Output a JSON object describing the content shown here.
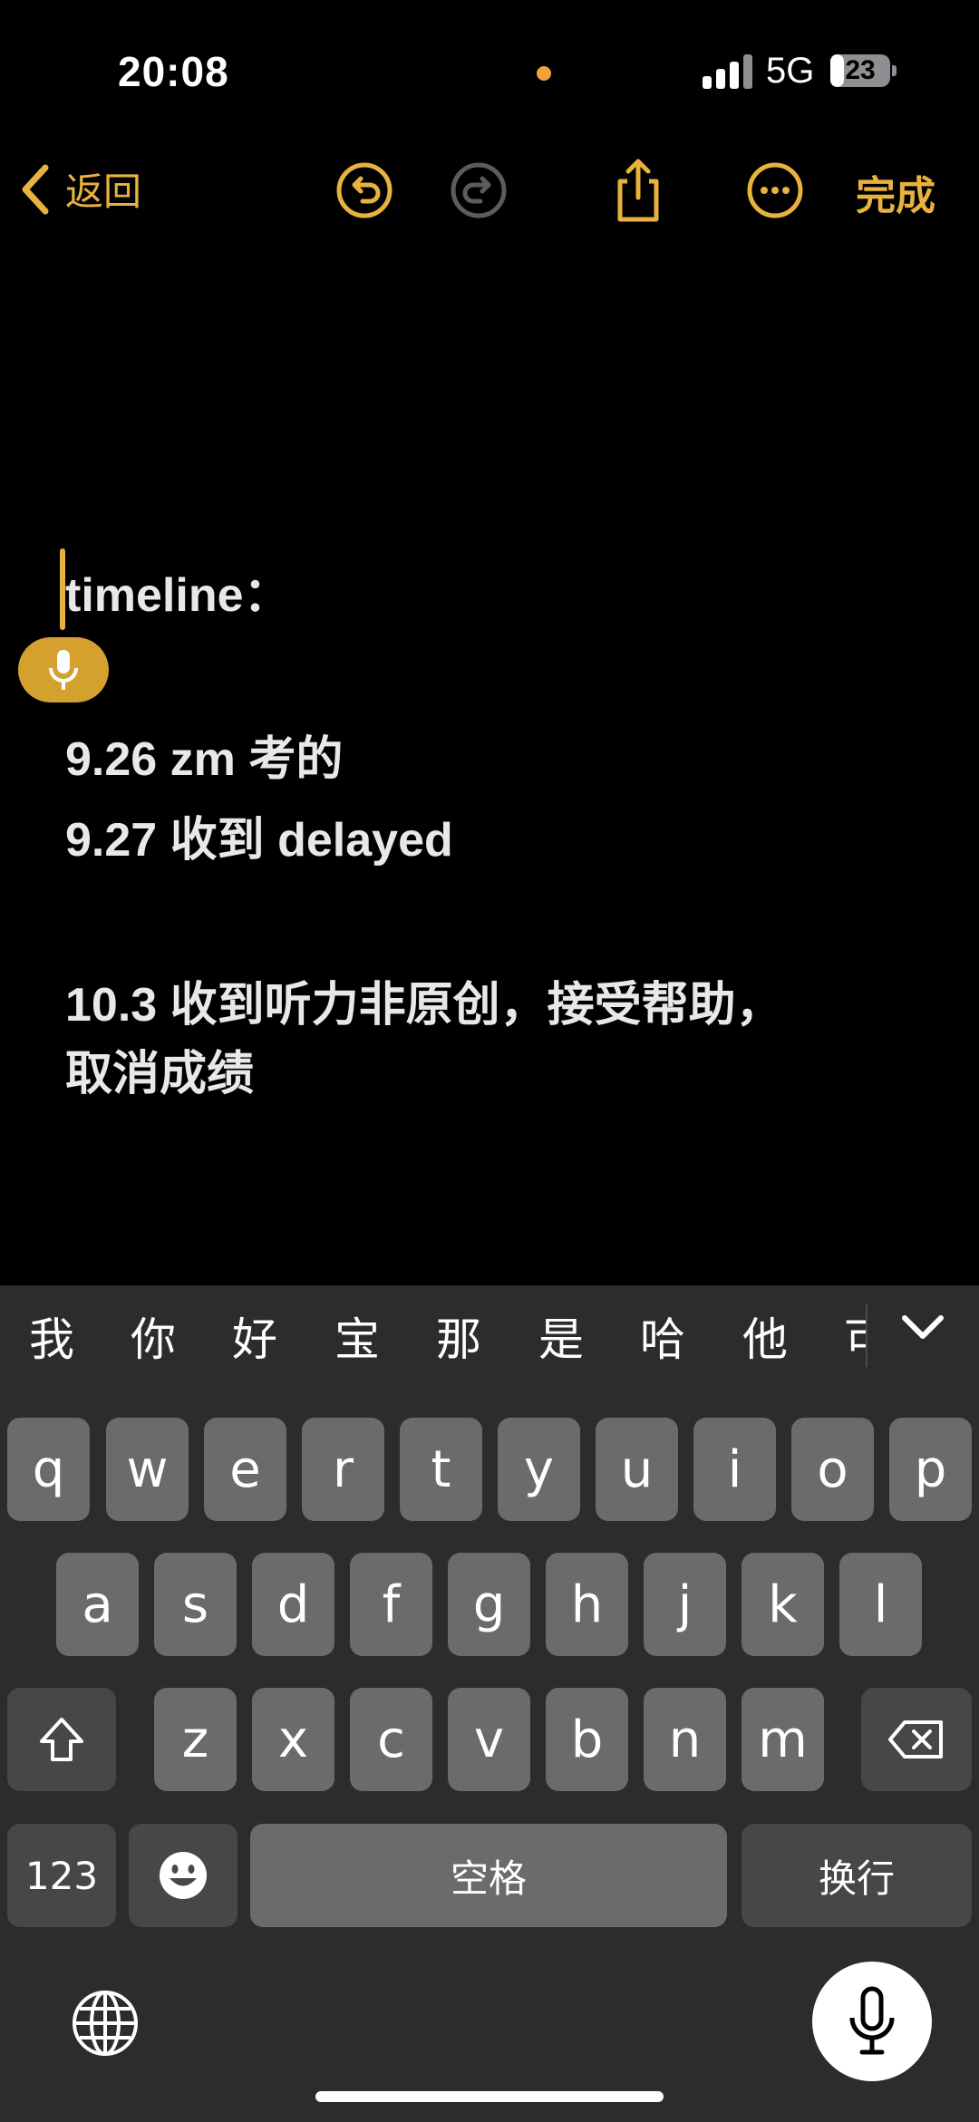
{
  "status": {
    "time": "20:08",
    "network": "5G",
    "battery": "23",
    "battery_level": 0.23
  },
  "toolbar": {
    "back_label": "返回",
    "done_label": "完成"
  },
  "note": {
    "title": "timeline：",
    "lines": [
      "9.26 zm 考的",
      "9.27 收到 delayed",
      "10.3 收到听力非原创，接受帮助，",
      "取消成绩"
    ]
  },
  "keyboard": {
    "candidates": [
      "我",
      "你",
      "好",
      "宝",
      "那",
      "是",
      "哈",
      "他",
      "可"
    ],
    "row1": [
      "q",
      "w",
      "e",
      "r",
      "t",
      "y",
      "u",
      "i",
      "o",
      "p"
    ],
    "row2": [
      "a",
      "s",
      "d",
      "f",
      "g",
      "h",
      "j",
      "k",
      "l"
    ],
    "row3": [
      "z",
      "x",
      "c",
      "v",
      "b",
      "n",
      "m"
    ],
    "numbers_label": "123",
    "space_label": "空格",
    "return_label": "换行"
  },
  "colors": {
    "accent": "#e8b23e",
    "keyboard_bg": "#2c2c2e",
    "key": "#6b6b6e",
    "key_dark": "#474749"
  }
}
